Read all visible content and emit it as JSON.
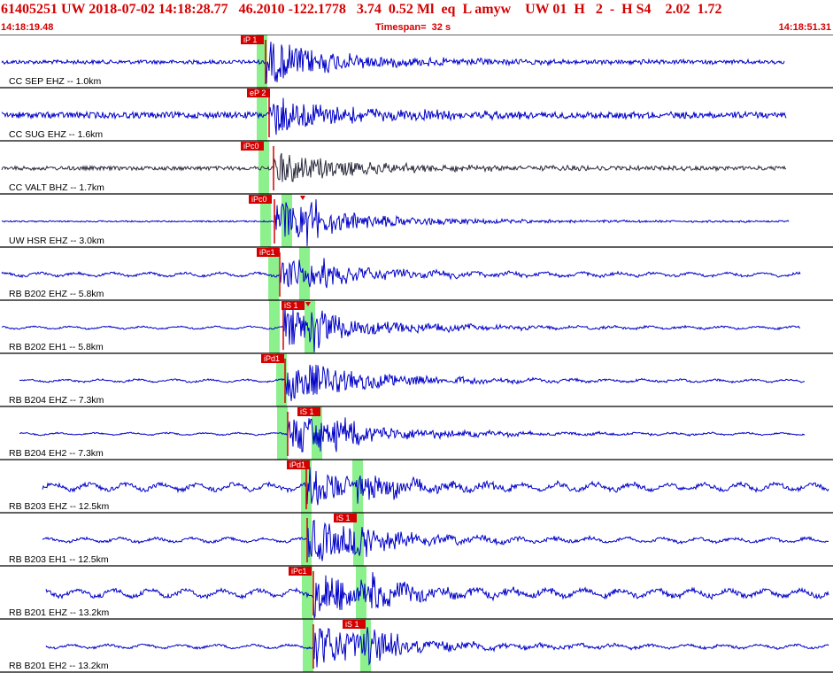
{
  "header": {
    "title": "61405251 UW 2018-07-02 14:18:28.77   46.2010 -122.1778   3.74  0.52 Ml  eq  L amyw    UW 01  H   2  -  H S4    2.02  1.72",
    "start_time": "14:18:19.48",
    "timespan": "Timespan=  32 s",
    "end_time": "14:18:51.31"
  },
  "colors": {
    "trace_default": "#0000c8",
    "trace_dark": "#2a2a3c",
    "pick": "#d40000",
    "window": "#8cf08c",
    "header_text": "#d40000"
  },
  "channels": [
    {
      "label": "CC SEP EHZ -- 1.0km",
      "pick": "iP 1",
      "color": "trace_default"
    },
    {
      "label": "CC SUG EHZ -- 1.6km",
      "pick": "eP 2",
      "color": "trace_default"
    },
    {
      "label": "CC VALT BHZ -- 1.7km",
      "pick": "iPc0",
      "color": "trace_dark"
    },
    {
      "label": "UW HSR EHZ -- 3.0km",
      "pick": "iPc0",
      "color": "trace_default"
    },
    {
      "label": "RB B202 EHZ -- 5.8km",
      "pick": "iPc1",
      "color": "trace_default"
    },
    {
      "label": "RB B202 EH1 -- 5.8km",
      "pick": "iS 1",
      "color": "trace_default"
    },
    {
      "label": "RB B204 EHZ -- 7.3km",
      "pick": "iPd1",
      "color": "trace_default"
    },
    {
      "label": "RB B204 EH2 -- 7.3km",
      "pick": "iS 1",
      "color": "trace_default"
    },
    {
      "label": "RB B203 EHZ -- 12.5km",
      "pick": "iPd1",
      "color": "trace_default"
    },
    {
      "label": "RB B203 EH1 -- 12.5km",
      "pick": "iS 1",
      "color": "trace_default"
    },
    {
      "label": "RB B201 EHZ -- 13.2km",
      "pick": "iPc1",
      "color": "trace_default"
    },
    {
      "label": "RB B201 EH2 -- 13.2km",
      "pick": "iS 1",
      "color": "trace_default"
    }
  ]
}
